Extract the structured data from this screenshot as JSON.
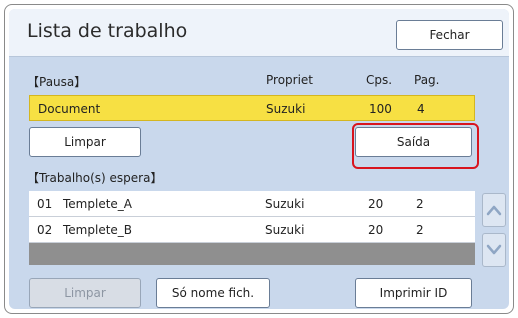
{
  "header": {
    "title": "Lista de trabalho",
    "close_label": "Fechar"
  },
  "paused": {
    "section_label": "【Pausa】",
    "columns": {
      "owner": "Propriet",
      "copies": "Cps.",
      "pages": "Pag."
    },
    "row": {
      "name": "Document",
      "owner": "Suzuki",
      "copies": "100",
      "pages": "4"
    }
  },
  "actions": {
    "clear_label": "Limpar",
    "output_label": "Saída"
  },
  "waiting": {
    "section_label": "【Trabalho(s) espera】",
    "rows": [
      {
        "num": "01",
        "name": "Templete_A",
        "owner": "Suzuki",
        "copies": "20",
        "pages": "2"
      },
      {
        "num": "02",
        "name": "Templete_B",
        "owner": "Suzuki",
        "copies": "20",
        "pages": "2"
      }
    ]
  },
  "footer": {
    "clear_label": "Limpar",
    "filename_only_label": "Só nome fich.",
    "print_id_label": "Imprimir ID"
  },
  "colors": {
    "highlight": "#d8141e",
    "paused_row": "#f7e043",
    "panel_bg": "#c9d8ec"
  },
  "icons": {
    "scroll_up": "chevron-up-icon",
    "scroll_down": "chevron-down-icon"
  }
}
